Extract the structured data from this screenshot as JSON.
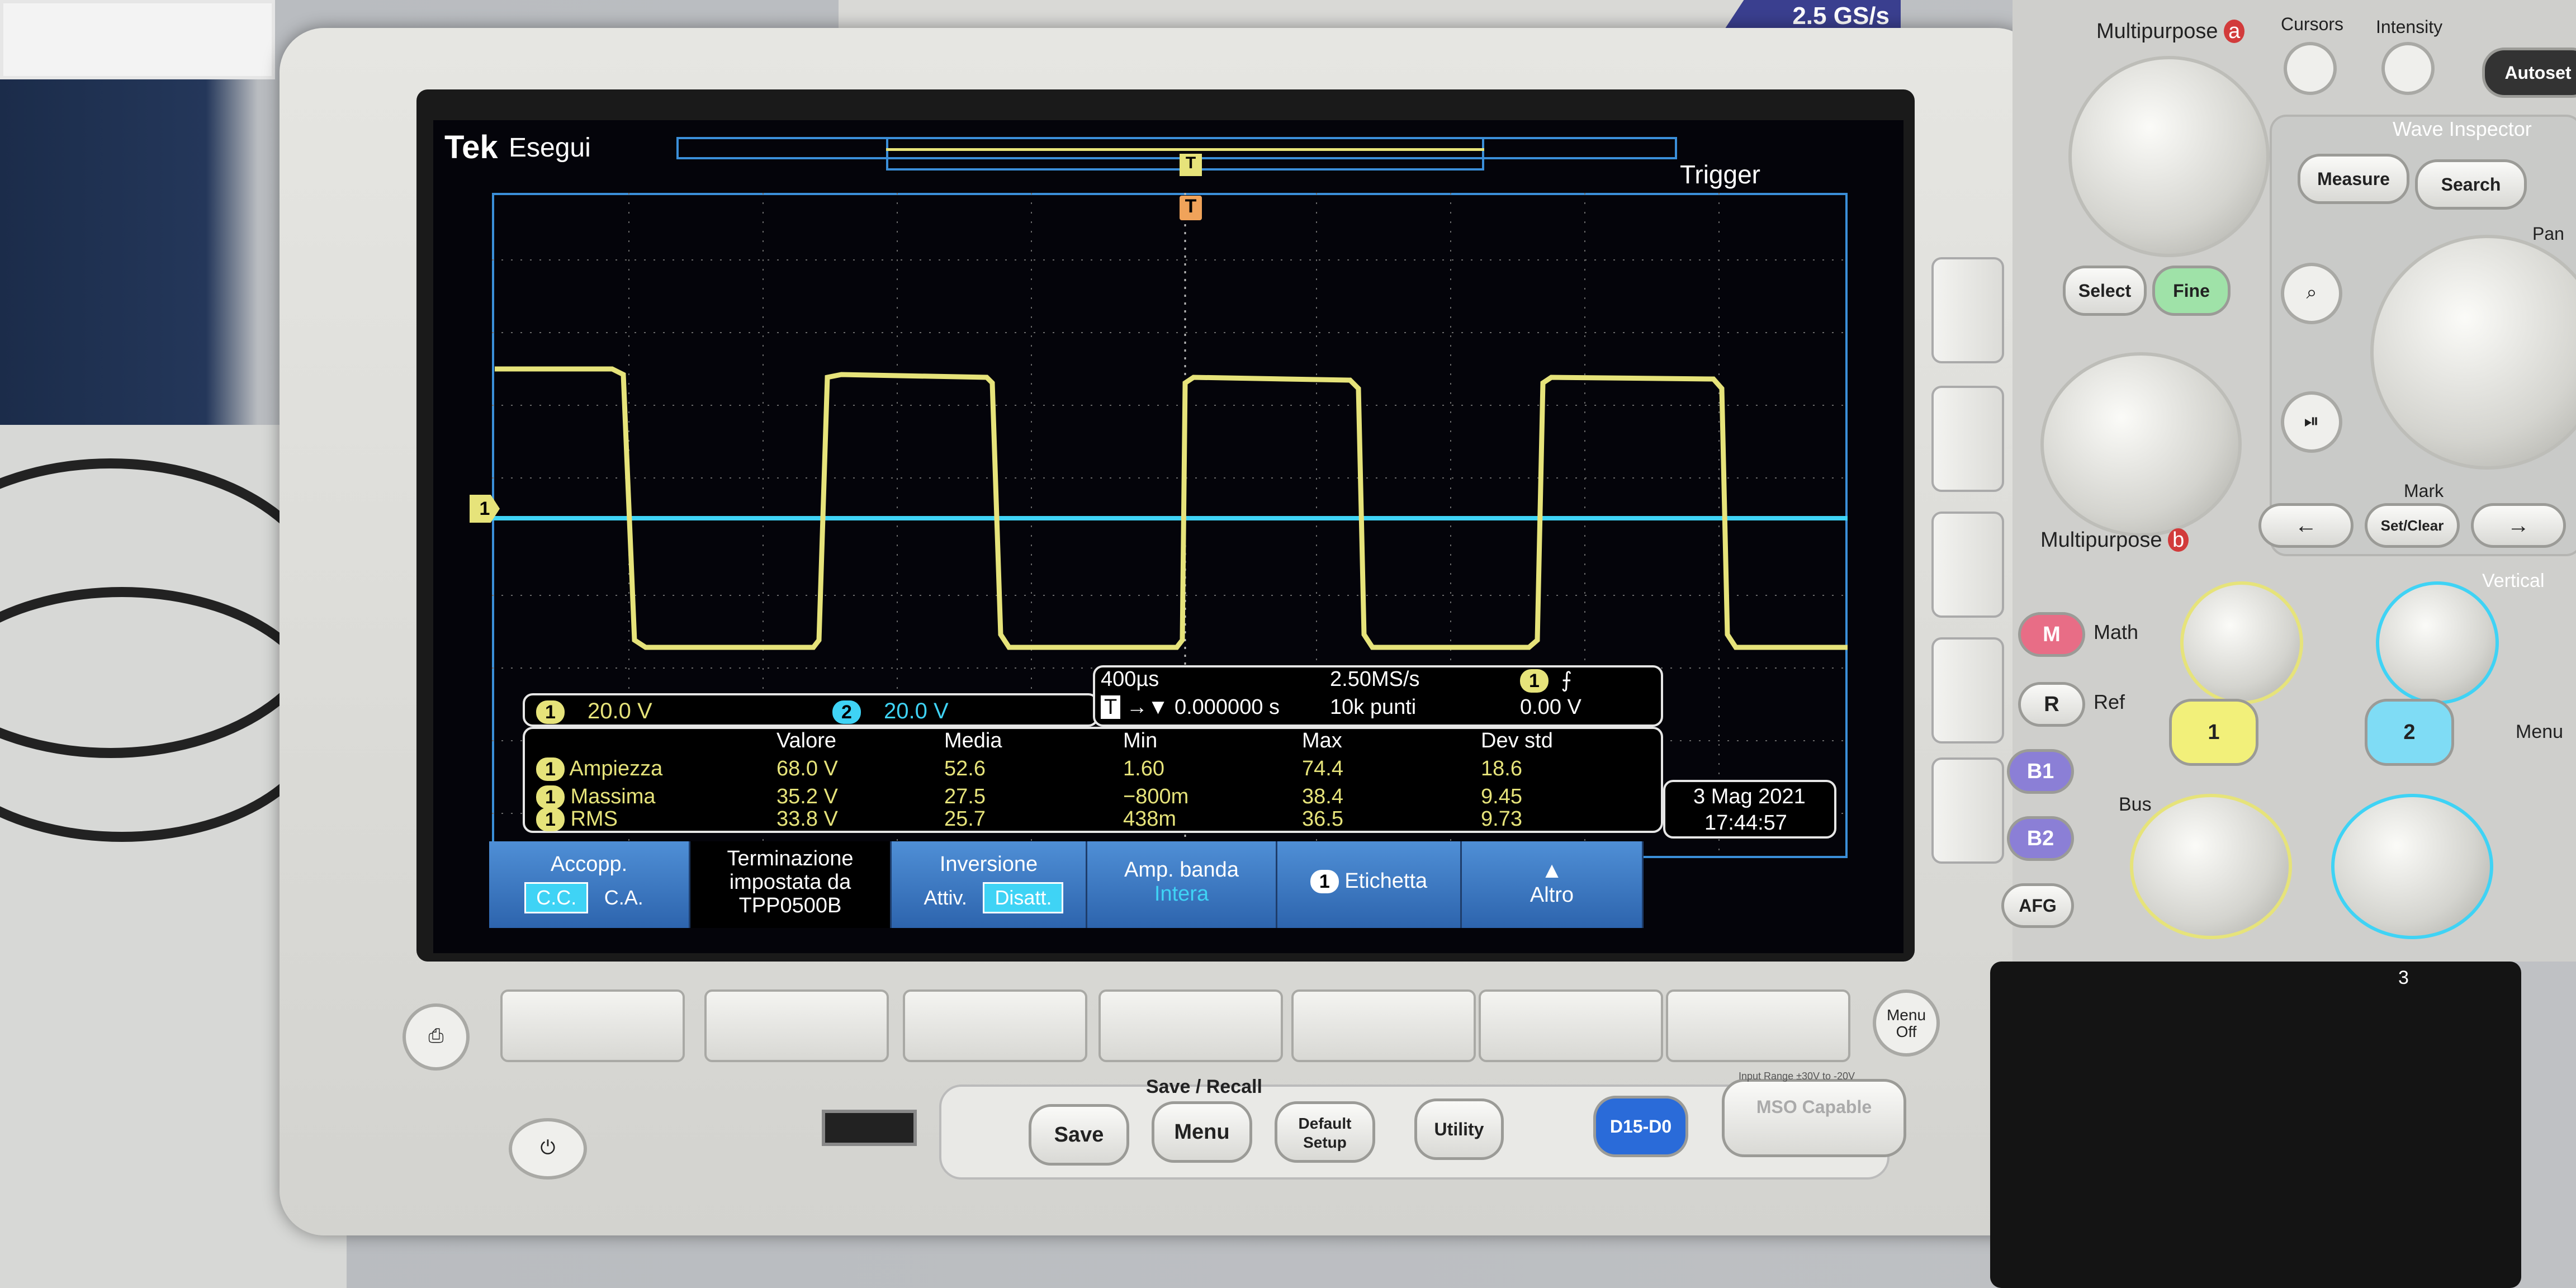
{
  "instrument": {
    "logo": "Tek",
    "run_status": "Esegui",
    "trigger_label": "Trigger",
    "sample_rate_badge": "2.5 GS/s",
    "trigger_marker": "T",
    "channel_marker": "1"
  },
  "channel_scales": [
    {
      "channel": "1",
      "value": "20.0 V",
      "color": "#e6e37a"
    },
    {
      "channel": "2",
      "value": "20.0 V",
      "color": "#3fd3f5"
    }
  ],
  "timebase": {
    "time_per_div": "400µs",
    "sample_rate": "2.50MS/s",
    "trigger_position": "0.000000 s",
    "record_length": "10k punti",
    "trigger_source": "1",
    "trigger_slope": "⨍",
    "trigger_level": "0.00 V"
  },
  "measurements": {
    "headers": [
      "Valore",
      "Media",
      "Min",
      "Max",
      "Dev std"
    ],
    "rows": [
      {
        "channel": "1",
        "name": "Ampiezza",
        "values": [
          "68.0 V",
          "52.6",
          "1.60",
          "74.4",
          "18.6"
        ]
      },
      {
        "channel": "1",
        "name": "Massima",
        "values": [
          "35.2 V",
          "27.5",
          "−800m",
          "38.4",
          "9.45"
        ]
      },
      {
        "channel": "1",
        "name": "RMS",
        "values": [
          "33.8 V",
          "25.7",
          "438m",
          "36.5",
          "9.73"
        ]
      }
    ]
  },
  "datetime": {
    "date": "3 Mag 2021",
    "time": "17:44:57"
  },
  "bottom_menu": [
    {
      "title": "Accopp.",
      "options": [
        "C.C.",
        "C.A."
      ],
      "selected": "C.C."
    },
    {
      "title": "Terminazione impostata da TPP0500B"
    },
    {
      "title": "Inversione",
      "options": [
        "Attiv.",
        "Disatt."
      ],
      "selected": "Disatt."
    },
    {
      "title": "Amp. banda",
      "value": "Intera"
    },
    {
      "title": "Etichetta",
      "chip": "1"
    },
    {
      "title": "Altro",
      "icon": "up-triangle-icon"
    }
  ],
  "waveform": {
    "channel1_color": "#e6e37a",
    "channel2_color": "#3fd3f5",
    "grid_color": "#3b8fd9",
    "description_kind": "square wave"
  },
  "front_panel": {
    "multipurpose_a": "Multipurpose",
    "multipurpose_a_badge": "a",
    "multipurpose_b": "Multipurpose",
    "multipurpose_b_badge": "b",
    "cursors": "Cursors",
    "intensity": "Intensity",
    "autoset": "Autoset",
    "wave_inspector": "Wave Inspector",
    "measure": "Measure",
    "search": "Search",
    "select": "Select",
    "fine": "Fine",
    "pan": "Pan",
    "mark": "Mark",
    "set_clear": "Set/Clear",
    "vertical": "Vertical",
    "math": "Math",
    "math_key": "M",
    "ref": "Ref",
    "ref_key": "R",
    "b1": "B1",
    "b2": "B2",
    "bus": "Bus",
    "afg": "AFG",
    "ch1": "1",
    "ch2": "2",
    "ch3": "3",
    "menu_label": "Menu",
    "menu_off": "Menu Off",
    "save_recall": "Save / Recall",
    "save": "Save",
    "menu": "Menu",
    "default_setup": "Default Setup",
    "utility": "Utility",
    "d15_d0": "D15-D0",
    "mso_capable": "MSO Capable",
    "input_range": "Input Range ±30V to -20V"
  }
}
